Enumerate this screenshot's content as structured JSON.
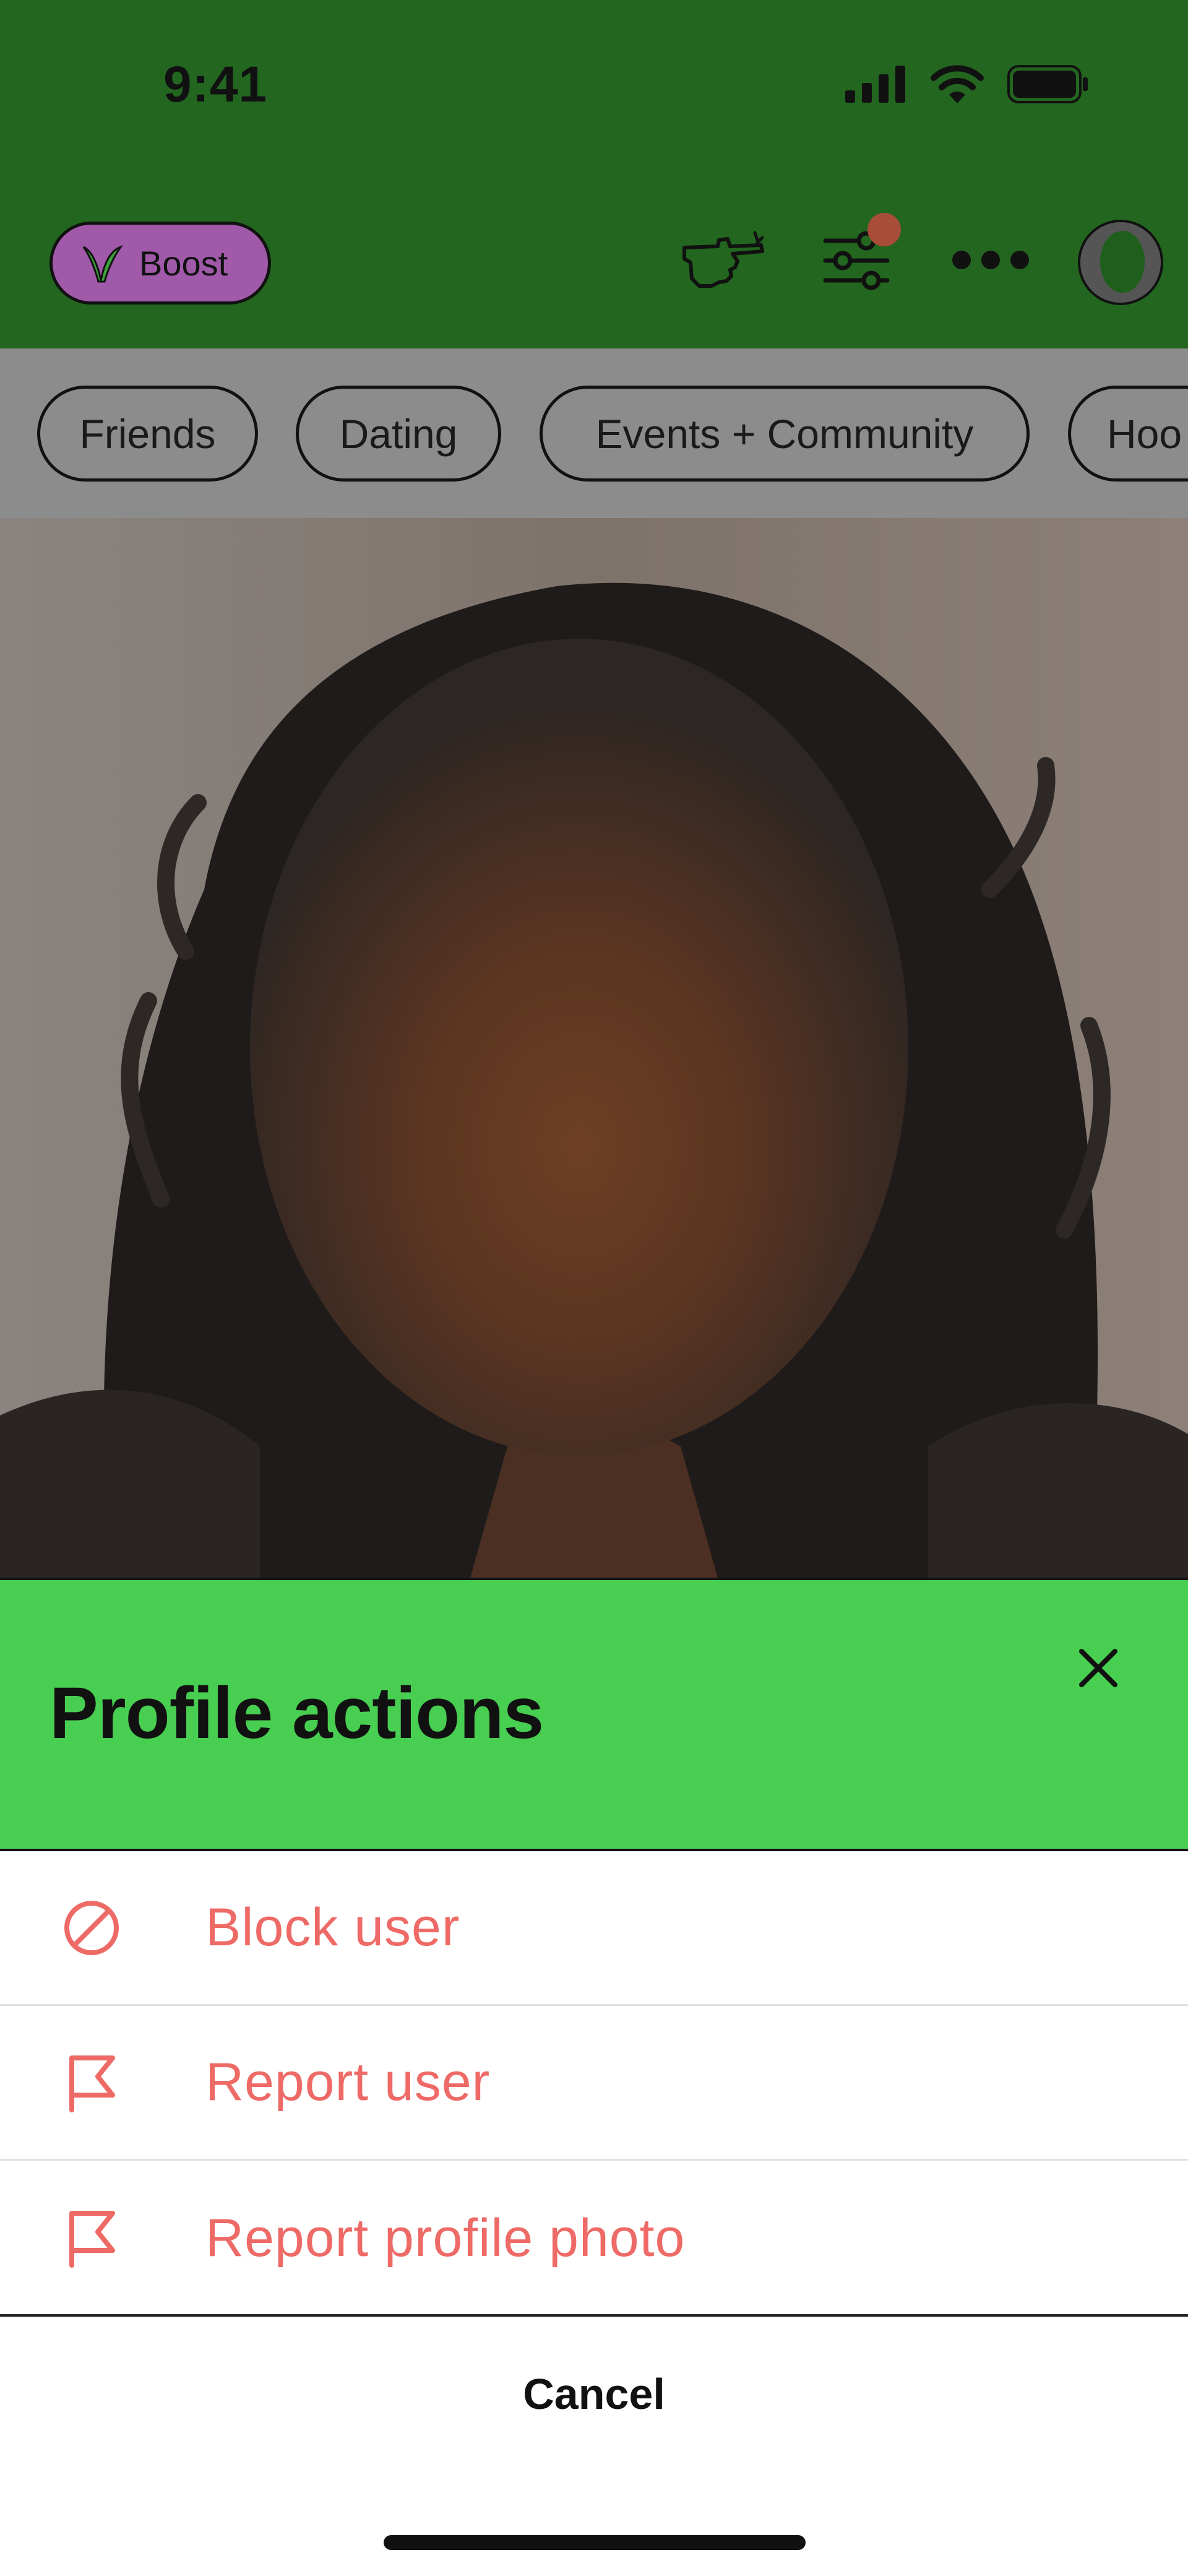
{
  "status_bar": {
    "time": "9:41",
    "icons": [
      "signal-icon",
      "wifi-icon",
      "battery-icon"
    ]
  },
  "header": {
    "boost_label": "Boost",
    "icons": [
      "pointing-hand-icon",
      "filter-sliders-icon",
      "more-options-icon",
      "profile-avatar"
    ],
    "notification_dot_color": "#a84d37"
  },
  "filters": {
    "chips": [
      "Friends",
      "Dating",
      "Events + Community",
      "Hoo"
    ]
  },
  "sheet": {
    "title": "Profile actions",
    "actions": [
      {
        "label": "Block user",
        "icon": "block-icon"
      },
      {
        "label": "Report user",
        "icon": "flag-icon"
      },
      {
        "label": "Report profile photo",
        "icon": "flag-icon"
      }
    ],
    "cancel_label": "Cancel"
  },
  "colors": {
    "header_bg": "#23661f",
    "sheet_header_bg": "#48ce51",
    "boost_bg": "#a05aa9",
    "destructive_text": "#ee6a66",
    "chip_bar_bg": "#8c8c8c"
  }
}
